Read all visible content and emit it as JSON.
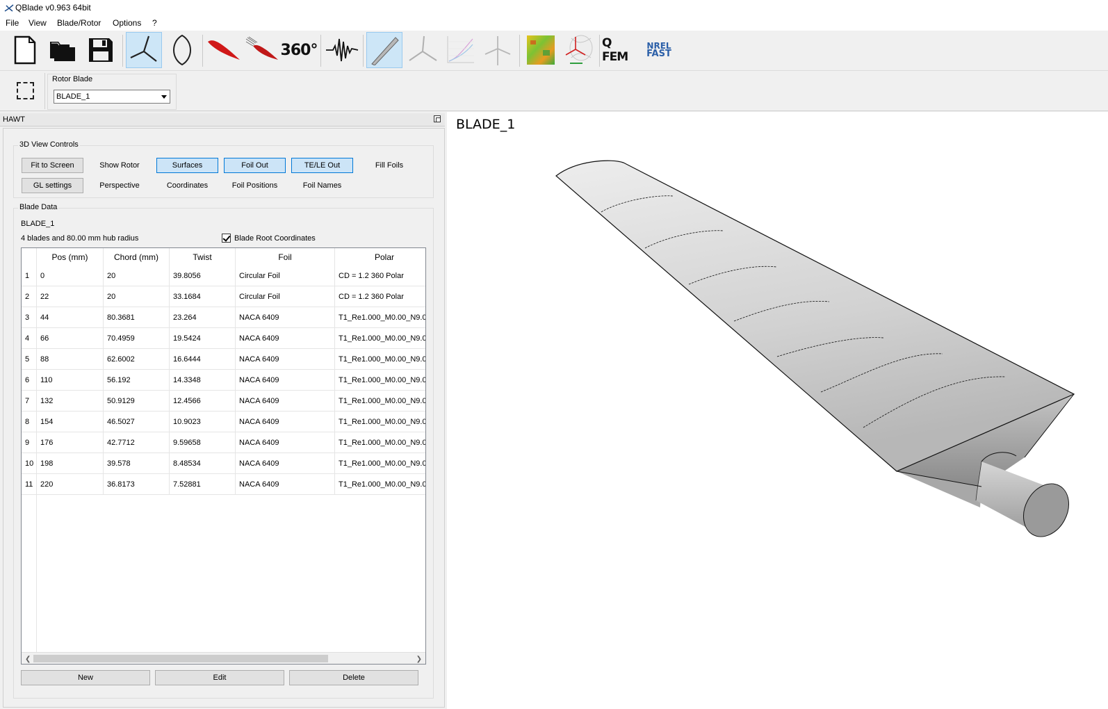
{
  "window": {
    "title": "QBlade v0.963 64bit"
  },
  "menu": [
    "File",
    "View",
    "Blade/Rotor",
    "Options",
    "?"
  ],
  "toolbar": {
    "text_360": "360°",
    "text_qfem": "Q FEM",
    "text_nrel": "NREL",
    "text_fast": "FAST"
  },
  "selector": {
    "group_label": "Rotor Blade",
    "selected_blade": "BLADE_1"
  },
  "dock": {
    "title": "HAWT"
  },
  "view_controls": {
    "title": "3D View Controls",
    "fit_to_screen": "Fit to Screen",
    "show_rotor": "Show Rotor",
    "surfaces": "Surfaces",
    "foil_out": "Foil Out",
    "te_le_out": "TE/LE Out",
    "fill_foils": "Fill Foils",
    "gl_settings": "GL settings",
    "perspective": "Perspective",
    "coordinates": "Coordinates",
    "foil_positions": "Foil Positions",
    "foil_names": "Foil Names"
  },
  "blade_data": {
    "title": "Blade Data",
    "blade_name": "BLADE_1",
    "info": "4 blades and 80.00 mm hub radius",
    "root_coords_label": "Blade Root Coordinates",
    "columns": [
      "Pos (mm)",
      "Chord (mm)",
      "Twist",
      "Foil",
      "Polar"
    ],
    "rows": [
      {
        "n": "1",
        "pos": "0",
        "chord": "20",
        "twist": "39.8056",
        "foil": "Circular Foil",
        "polar": "CD = 1.2     360 Polar"
      },
      {
        "n": "2",
        "pos": "22",
        "chord": "20",
        "twist": "33.1684",
        "foil": "Circular Foil",
        "polar": "CD = 1.2     360 Polar"
      },
      {
        "n": "3",
        "pos": "44",
        "chord": "80.3681",
        "twist": "23.264",
        "foil": "NACA 6409",
        "polar": "T1_Re1.000_M0.00_N9.0"
      },
      {
        "n": "4",
        "pos": "66",
        "chord": "70.4959",
        "twist": "19.5424",
        "foil": "NACA 6409",
        "polar": "T1_Re1.000_M0.00_N9.0"
      },
      {
        "n": "5",
        "pos": "88",
        "chord": "62.6002",
        "twist": "16.6444",
        "foil": "NACA 6409",
        "polar": "T1_Re1.000_M0.00_N9.0"
      },
      {
        "n": "6",
        "pos": "110",
        "chord": "56.192",
        "twist": "14.3348",
        "foil": "NACA 6409",
        "polar": "T1_Re1.000_M0.00_N9.0"
      },
      {
        "n": "7",
        "pos": "132",
        "chord": "50.9129",
        "twist": "12.4566",
        "foil": "NACA 6409",
        "polar": "T1_Re1.000_M0.00_N9.0"
      },
      {
        "n": "8",
        "pos": "154",
        "chord": "46.5027",
        "twist": "10.9023",
        "foil": "NACA 6409",
        "polar": "T1_Re1.000_M0.00_N9.0"
      },
      {
        "n": "9",
        "pos": "176",
        "chord": "42.7712",
        "twist": "9.59658",
        "foil": "NACA 6409",
        "polar": "T1_Re1.000_M0.00_N9.0"
      },
      {
        "n": "10",
        "pos": "198",
        "chord": "39.578",
        "twist": "8.48534",
        "foil": "NACA 6409",
        "polar": "T1_Re1.000_M0.00_N9.0"
      },
      {
        "n": "11",
        "pos": "220",
        "chord": "36.8173",
        "twist": "7.52881",
        "foil": "NACA 6409",
        "polar": "T1_Re1.000_M0.00_N9.0"
      }
    ],
    "buttons": {
      "new": "New",
      "edit": "Edit",
      "delete": "Delete"
    }
  },
  "view3d": {
    "title": "BLADE_1"
  }
}
